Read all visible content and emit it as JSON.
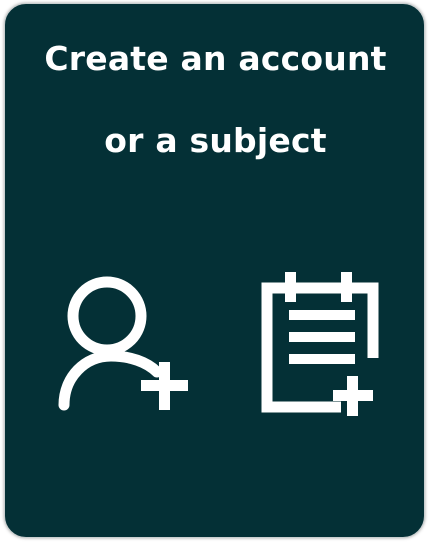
{
  "card": {
    "title_line1": "Create an account",
    "title_line2": "or a subject",
    "background_color": "#043036",
    "text_color": "#ffffff"
  },
  "actions": [
    {
      "icon": "add-user-icon"
    },
    {
      "icon": "add-subject-icon"
    }
  ]
}
